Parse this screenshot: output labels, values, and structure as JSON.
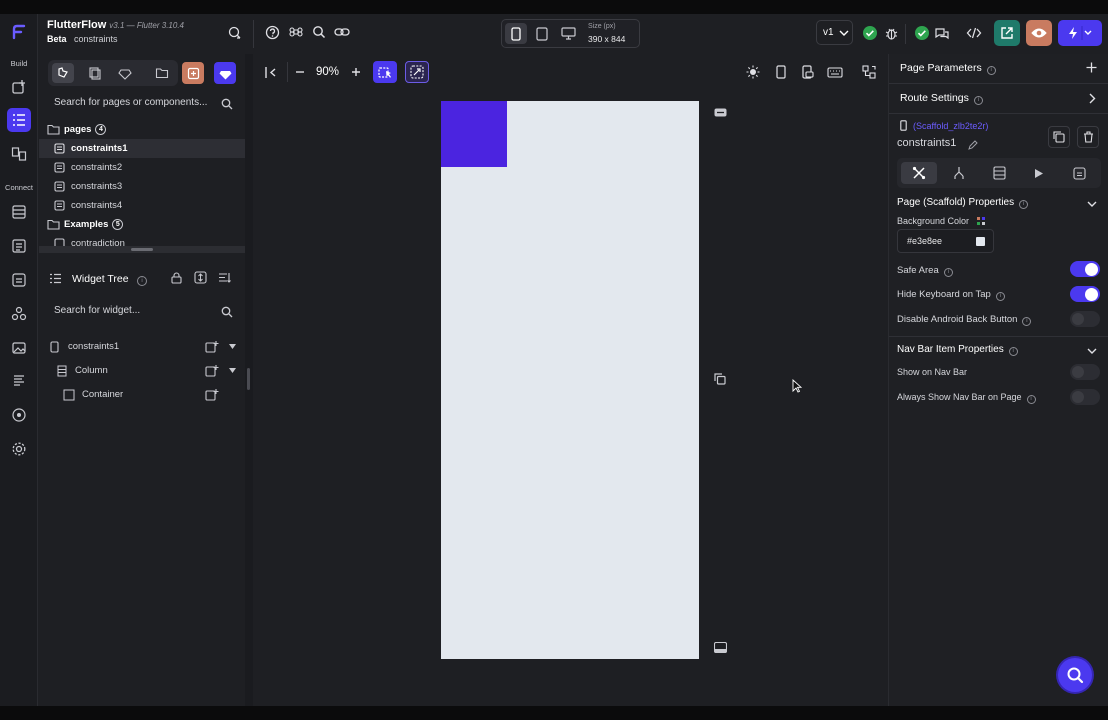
{
  "app": {
    "name": "FlutterFlow",
    "version": "v3.1 — Flutter 3.10.4",
    "beta": "Beta",
    "project": "constraints"
  },
  "rail": {
    "build_label": "Build",
    "connect_label": "Connect"
  },
  "device_bar": {
    "size_label": "Size (px)",
    "size_value": "390 x 844"
  },
  "version_select": {
    "value": "v1"
  },
  "canvas": {
    "zoom": "90%",
    "page_background": "#e3e8ee",
    "container_color": "#4b24e0"
  },
  "left_panel": {
    "search_pages_placeholder": "Search for pages or components...",
    "pages_folder": "pages",
    "pages_count": "4",
    "pages": [
      "constraints1",
      "constraints2",
      "constraints3",
      "constraints4"
    ],
    "selected_page": "constraints1",
    "examples_folder": "Examples",
    "examples_count": "5",
    "partial_item": "contradiction",
    "widget_tree_title": "Widget Tree",
    "search_widget_placeholder": "Search for widget...",
    "tree": [
      "constraints1",
      "Column",
      "Container"
    ]
  },
  "right_panel": {
    "page_parameters": "Page Parameters",
    "route_settings": "Route Settings",
    "scaffold_id": "(Scaffold_zlb2te2r)",
    "page_name": "constraints1",
    "page_props_title": "Page (Scaffold) Properties",
    "background_color_label": "Background Color",
    "background_color_value": "#e3e8ee",
    "safe_area": "Safe Area",
    "hide_keyboard": "Hide Keyboard on Tap",
    "disable_back": "Disable Android Back Button",
    "nav_bar_title": "Nav Bar Item Properties",
    "show_nav": "Show on Nav Bar",
    "always_show_nav": "Always Show Nav Bar on Page",
    "toggles": {
      "safe_area": true,
      "hide_keyboard": true,
      "disable_back": false,
      "show_nav": false,
      "always_show_nav": false
    }
  },
  "colors": {
    "accent": "#4b39ef",
    "background": "#1e1f23",
    "success": "#2ea44f",
    "run": "#c97b60"
  }
}
